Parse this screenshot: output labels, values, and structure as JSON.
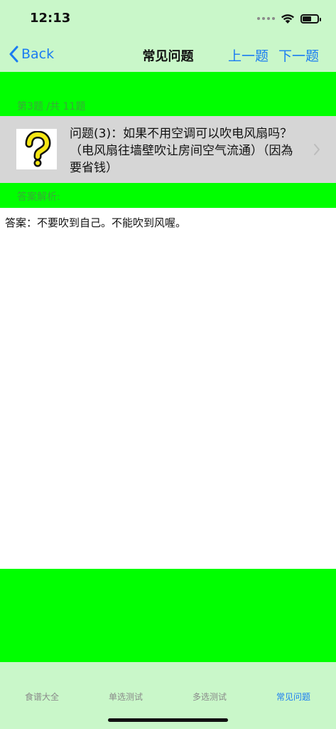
{
  "status_bar": {
    "time": "12:13"
  },
  "navbar": {
    "back_label": "Back",
    "title": "常见问题",
    "prev_label": "上一题",
    "next_label": "下一题"
  },
  "question": {
    "counter": "第3题 /共 11题",
    "text": "问题(3)：如果不用空调可以吹电风扇吗？（电风扇往墙壁吹让房间空气流通）（因為要省钱）",
    "image_icon": "question-mark-icon"
  },
  "analysis": {
    "label": "答案解析:",
    "answer": "答案：不要吹到自己。不能吹到风喔。"
  },
  "tabbar": {
    "tabs": [
      {
        "label": "食谱大全"
      },
      {
        "label": "单选测试"
      },
      {
        "label": "多选测试"
      },
      {
        "label": "常见问题"
      }
    ]
  },
  "colors": {
    "accent": "#1a7cf2",
    "bar_background": "#c9f7c9",
    "section_green": "#00ff00",
    "row_gray": "#d6d6d6"
  }
}
